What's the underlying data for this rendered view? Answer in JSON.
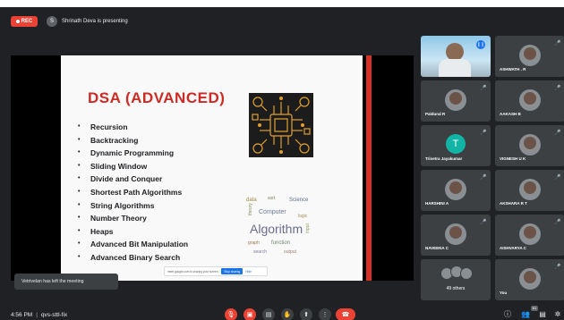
{
  "top_bar": {
    "rec_label": "REC",
    "presenter_initial": "S",
    "presenting_text": "Shrinath Deva is presenting"
  },
  "slide": {
    "title": "DSA (ADVANCED)",
    "topics": [
      "Recursion",
      "Backtracking",
      "Dynamic Programming",
      "Sliding Window",
      "Divide and Conquer",
      "Shortest Path Algorithms",
      "String Algorithms",
      "Number Theory",
      "Heaps",
      "Advanced Bit Manipulation",
      "Advanced Binary Search"
    ],
    "bullet": "•",
    "word_cloud_main": "Algorithm",
    "share_bar": {
      "message": "meet.google.com is sharing your screen.",
      "stop_label": "Stop sharing",
      "hide_label": "Hide"
    }
  },
  "participants": [
    {
      "name": "",
      "type": "video-self"
    },
    {
      "name": "ASHWATH . R",
      "type": "photo"
    },
    {
      "name": "Paldural R",
      "type": "photo"
    },
    {
      "name": "AAKASH B",
      "type": "photo"
    },
    {
      "name": "Trinetra Jayakumar",
      "type": "letter",
      "letter": "T"
    },
    {
      "name": "VIGNESH U K",
      "type": "photo"
    },
    {
      "name": "HARSHINI A",
      "type": "photo"
    },
    {
      "name": "AKSHARA R T",
      "type": "photo"
    },
    {
      "name": "NAVEENA C",
      "type": "photo"
    },
    {
      "name": "AISHVARYA C",
      "type": "photo"
    },
    {
      "name": "49 others",
      "type": "group"
    },
    {
      "name": "You",
      "type": "photo"
    }
  ],
  "toast": {
    "message": "Vetrivelan has left the meeting"
  },
  "bottom_bar": {
    "time": "4:56 PM",
    "separator": "|",
    "meeting_code": "qvs-sttl-fix",
    "participant_count": "61"
  },
  "colors": {
    "background": "#202124",
    "tile": "#3c4043",
    "accent_red": "#ea4335",
    "slide_title_red": "#cc2a24",
    "letter_avatar": "#12b5a5",
    "primary_blue": "#1a73e8"
  },
  "icons": {
    "mic_off": "mic-off-icon",
    "speaking": "speaking-icon",
    "captions": "captions-icon",
    "present": "present-icon",
    "raise_hand": "raise-hand-icon",
    "more": "more-options-icon",
    "end_call": "end-call-icon",
    "info": "info-icon",
    "people": "people-icon",
    "chat": "chat-icon",
    "activities": "activities-icon"
  }
}
